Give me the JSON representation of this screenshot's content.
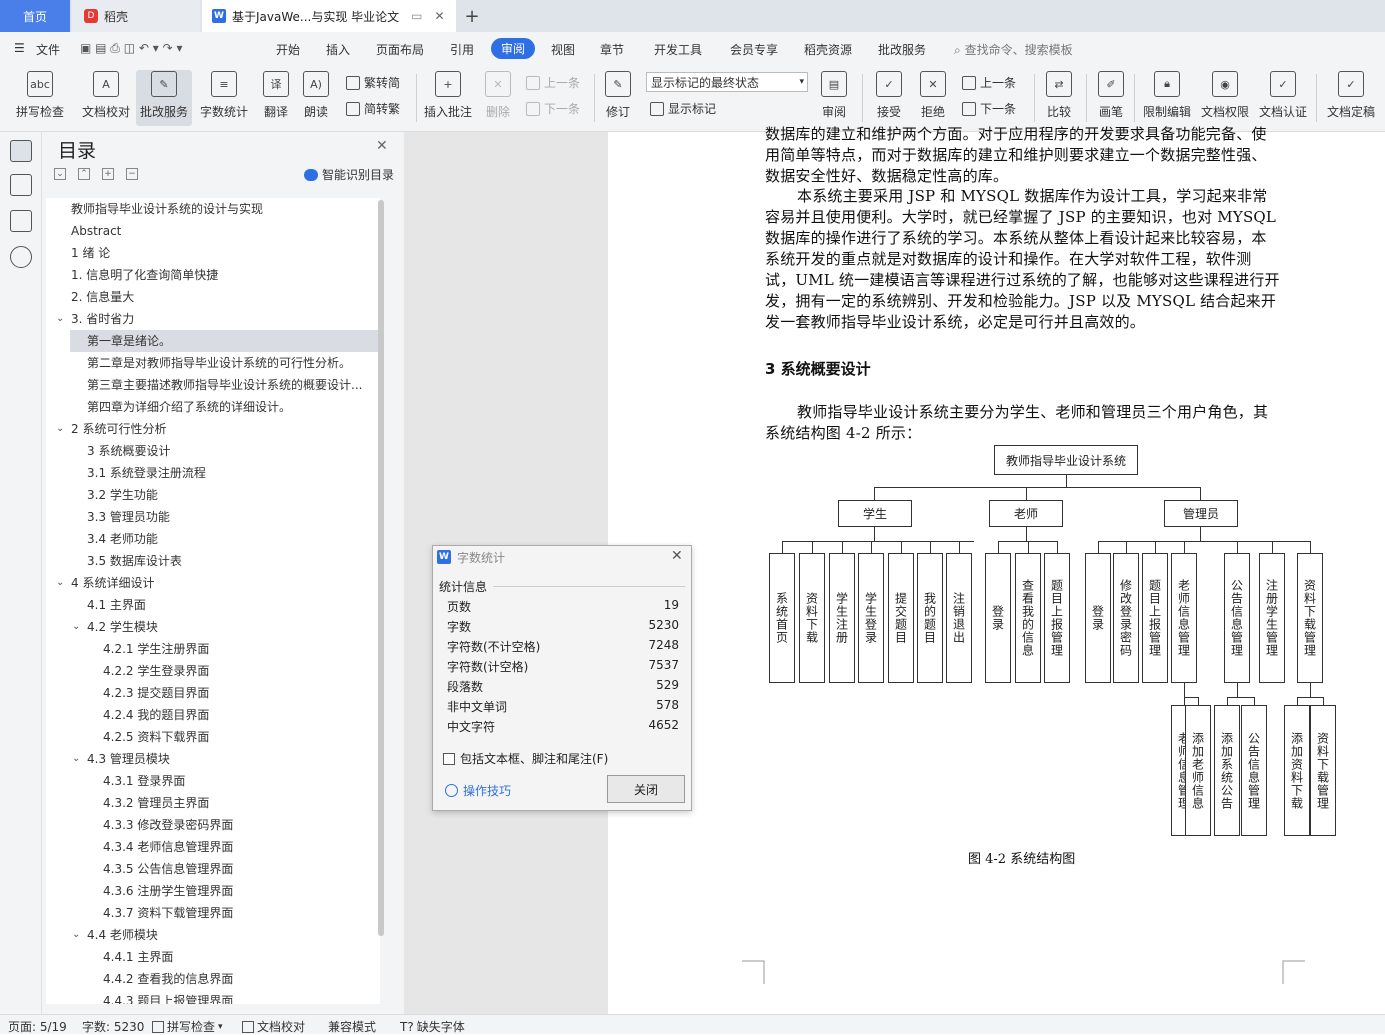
{
  "tabs": {
    "home": "首页",
    "daoke": "稻壳",
    "doc": "基于JavaWe...与实现 毕业论文"
  },
  "menu": {
    "file": "文件",
    "items": [
      "开始",
      "插入",
      "页面布局",
      "引用",
      "审阅",
      "视图",
      "章节",
      "开发工具",
      "会员专享",
      "稻壳资源",
      "批改服务"
    ],
    "search": "查找命令、搜索模板"
  },
  "ribbon": {
    "spell": "拼写检查",
    "doc_check": "文档校对",
    "revise_service": "批改服务",
    "word_count": "字数统计",
    "translate": "翻译",
    "read_aloud": "朗读",
    "to_trad": "繁转简",
    "to_simp": "简转繁",
    "insert_comment": "插入批注",
    "delete": "删除",
    "prev_comment": "上一条",
    "next_comment": "下一条",
    "revise": "修订",
    "markup_state": "显示标记的最终状态",
    "show_markup": "显示标记",
    "review": "审阅",
    "accept": "接受",
    "reject": "拒绝",
    "prev_change": "上一条",
    "next_change": "下一条",
    "compare": "比较",
    "pen": "画笔",
    "restrict_edit": "限制编辑",
    "doc_permission": "文档权限",
    "doc_cert": "文档认证",
    "doc_final": "文档定稿"
  },
  "toc": {
    "title": "目录",
    "smart": "智能识别目录",
    "items": [
      {
        "label": "教师指导毕业设计系统的设计与实现"
      },
      {
        "label": "Abstract"
      },
      {
        "label": "1  绪 论"
      },
      {
        "label": "1. 信息明了化查询简单快捷"
      },
      {
        "label": "2. 信息量大"
      },
      {
        "label": "3. 省时省力"
      },
      {
        "label": "第一章是绪论。"
      },
      {
        "label": "第二章是对教师指导毕业设计系统的可行性分析。"
      },
      {
        "label": "第三章主要描述教师指导毕业设计系统的概要设计..."
      },
      {
        "label": "第四章为详细介绍了系统的详细设计。"
      },
      {
        "label": "2   系统可行性分析"
      },
      {
        "label": "3 系统概要设计"
      },
      {
        "label": "3.1 系统登录注册流程"
      },
      {
        "label": "3.2 学生功能"
      },
      {
        "label": "3.3 管理员功能"
      },
      {
        "label": "3.4 老师功能"
      },
      {
        "label": "3.5 数据库设计表"
      },
      {
        "label": "4  系统详细设计"
      },
      {
        "label": "4.1 主界面"
      },
      {
        "label": "4.2 学生模块"
      },
      {
        "label": "4.2.1 学生注册界面"
      },
      {
        "label": "4.2.2 学生登录界面"
      },
      {
        "label": "4.2.3 提交题目界面"
      },
      {
        "label": "4.2.4 我的题目界面"
      },
      {
        "label": "4.2.5 资料下载界面"
      },
      {
        "label": "4.3 管理员模块"
      },
      {
        "label": "4.3.1 登录界面"
      },
      {
        "label": "4.3.2 管理员主界面"
      },
      {
        "label": "4.3.3 修改登录密码界面"
      },
      {
        "label": "4.3.4 老师信息管理界面"
      },
      {
        "label": "4.3.5 公告信息管理界面"
      },
      {
        "label": "4.3.6 注册学生管理界面"
      },
      {
        "label": "4.3.7 资料下载管理界面"
      },
      {
        "label": "4.4 老师模块"
      },
      {
        "label": "4.4.1 主界面"
      },
      {
        "label": "4.4.2 查看我的信息界面"
      },
      {
        "label": "4.4.3 题目上报管理界面"
      }
    ]
  },
  "document": {
    "p1": "数据库的建立和维护两个方面。对于应用程序的开发要求具备功能完备、使用简单等特点，而对于数据库的建立和维护则要求建立一个数据完整性强、数据安全性好、数据稳定性高的库。",
    "p2": "本系统主要采用 JSP 和 MYSQL 数据库作为设计工具，学习起来非常容易并且使用便利。大学时，就已经掌握了 JSP 的主要知识，也对 MYSQL 数据库的操作进行了系统的学习。本系统从整体上看设计起来比较容易，本系统开发的重点就是对数据库的设计和操作。在大学对软件工程，软件测试，UML 统一建模语言等课程进行过系统的了解，也能够对这些课程进行开发，拥有一定的系统辨别、开发和检验能力。JSP 以及 MYSQL 结合起来开发一套教师指导毕业设计系统，必定是可行并且高效的。",
    "heading": "3 系统概要设计",
    "p3": "教师指导毕业设计系统主要分为学生、老师和管理员三个用户角色，其系统结构图 4-2 所示：",
    "caption": "图 4-2 系统结构图"
  },
  "diagram": {
    "root": "教师指导毕业设计系统",
    "student": "学生",
    "teacher": "老师",
    "admin": "管理员",
    "student_items": [
      "系统首页",
      "资料下载",
      "学生注册",
      "学生登录",
      "提交题目",
      "我的题目",
      "注销退出"
    ],
    "teacher_items": [
      "登录",
      "查看我的信息",
      "题目上报管理"
    ],
    "admin_items": [
      "登录",
      "修改登录密码",
      "题目上报管理",
      "老师信息管理",
      "公告信息管理",
      "注册学生管理",
      "资料下载管理"
    ],
    "teacher_mgmt_sub": [
      "老师信息管理",
      "添加老师信息"
    ],
    "notice_sub": [
      "添加系统公告",
      "公告信息管理"
    ],
    "download_sub": [
      "添加资料下载",
      "资料下载管理"
    ]
  },
  "dialog": {
    "title": "字数统计",
    "group": "统计信息",
    "rows": [
      {
        "k": "页数",
        "v": "19"
      },
      {
        "k": "字数",
        "v": "5230"
      },
      {
        "k": "字符数(不计空格)",
        "v": "7248"
      },
      {
        "k": "字符数(计空格)",
        "v": "7537"
      },
      {
        "k": "段落数",
        "v": "529"
      },
      {
        "k": "非中文单词",
        "v": "578"
      },
      {
        "k": "中文字符",
        "v": "4652"
      }
    ],
    "include": "包括文本框、脚注和尾注(F)",
    "tips": "操作技巧",
    "close": "关闭"
  },
  "status": {
    "page": "页面: 5/19",
    "words": "字数: 5230",
    "spell": "拼写检查",
    "doc_check": "文档校对",
    "compat": "兼容模式",
    "missing_font": "缺失字体"
  }
}
